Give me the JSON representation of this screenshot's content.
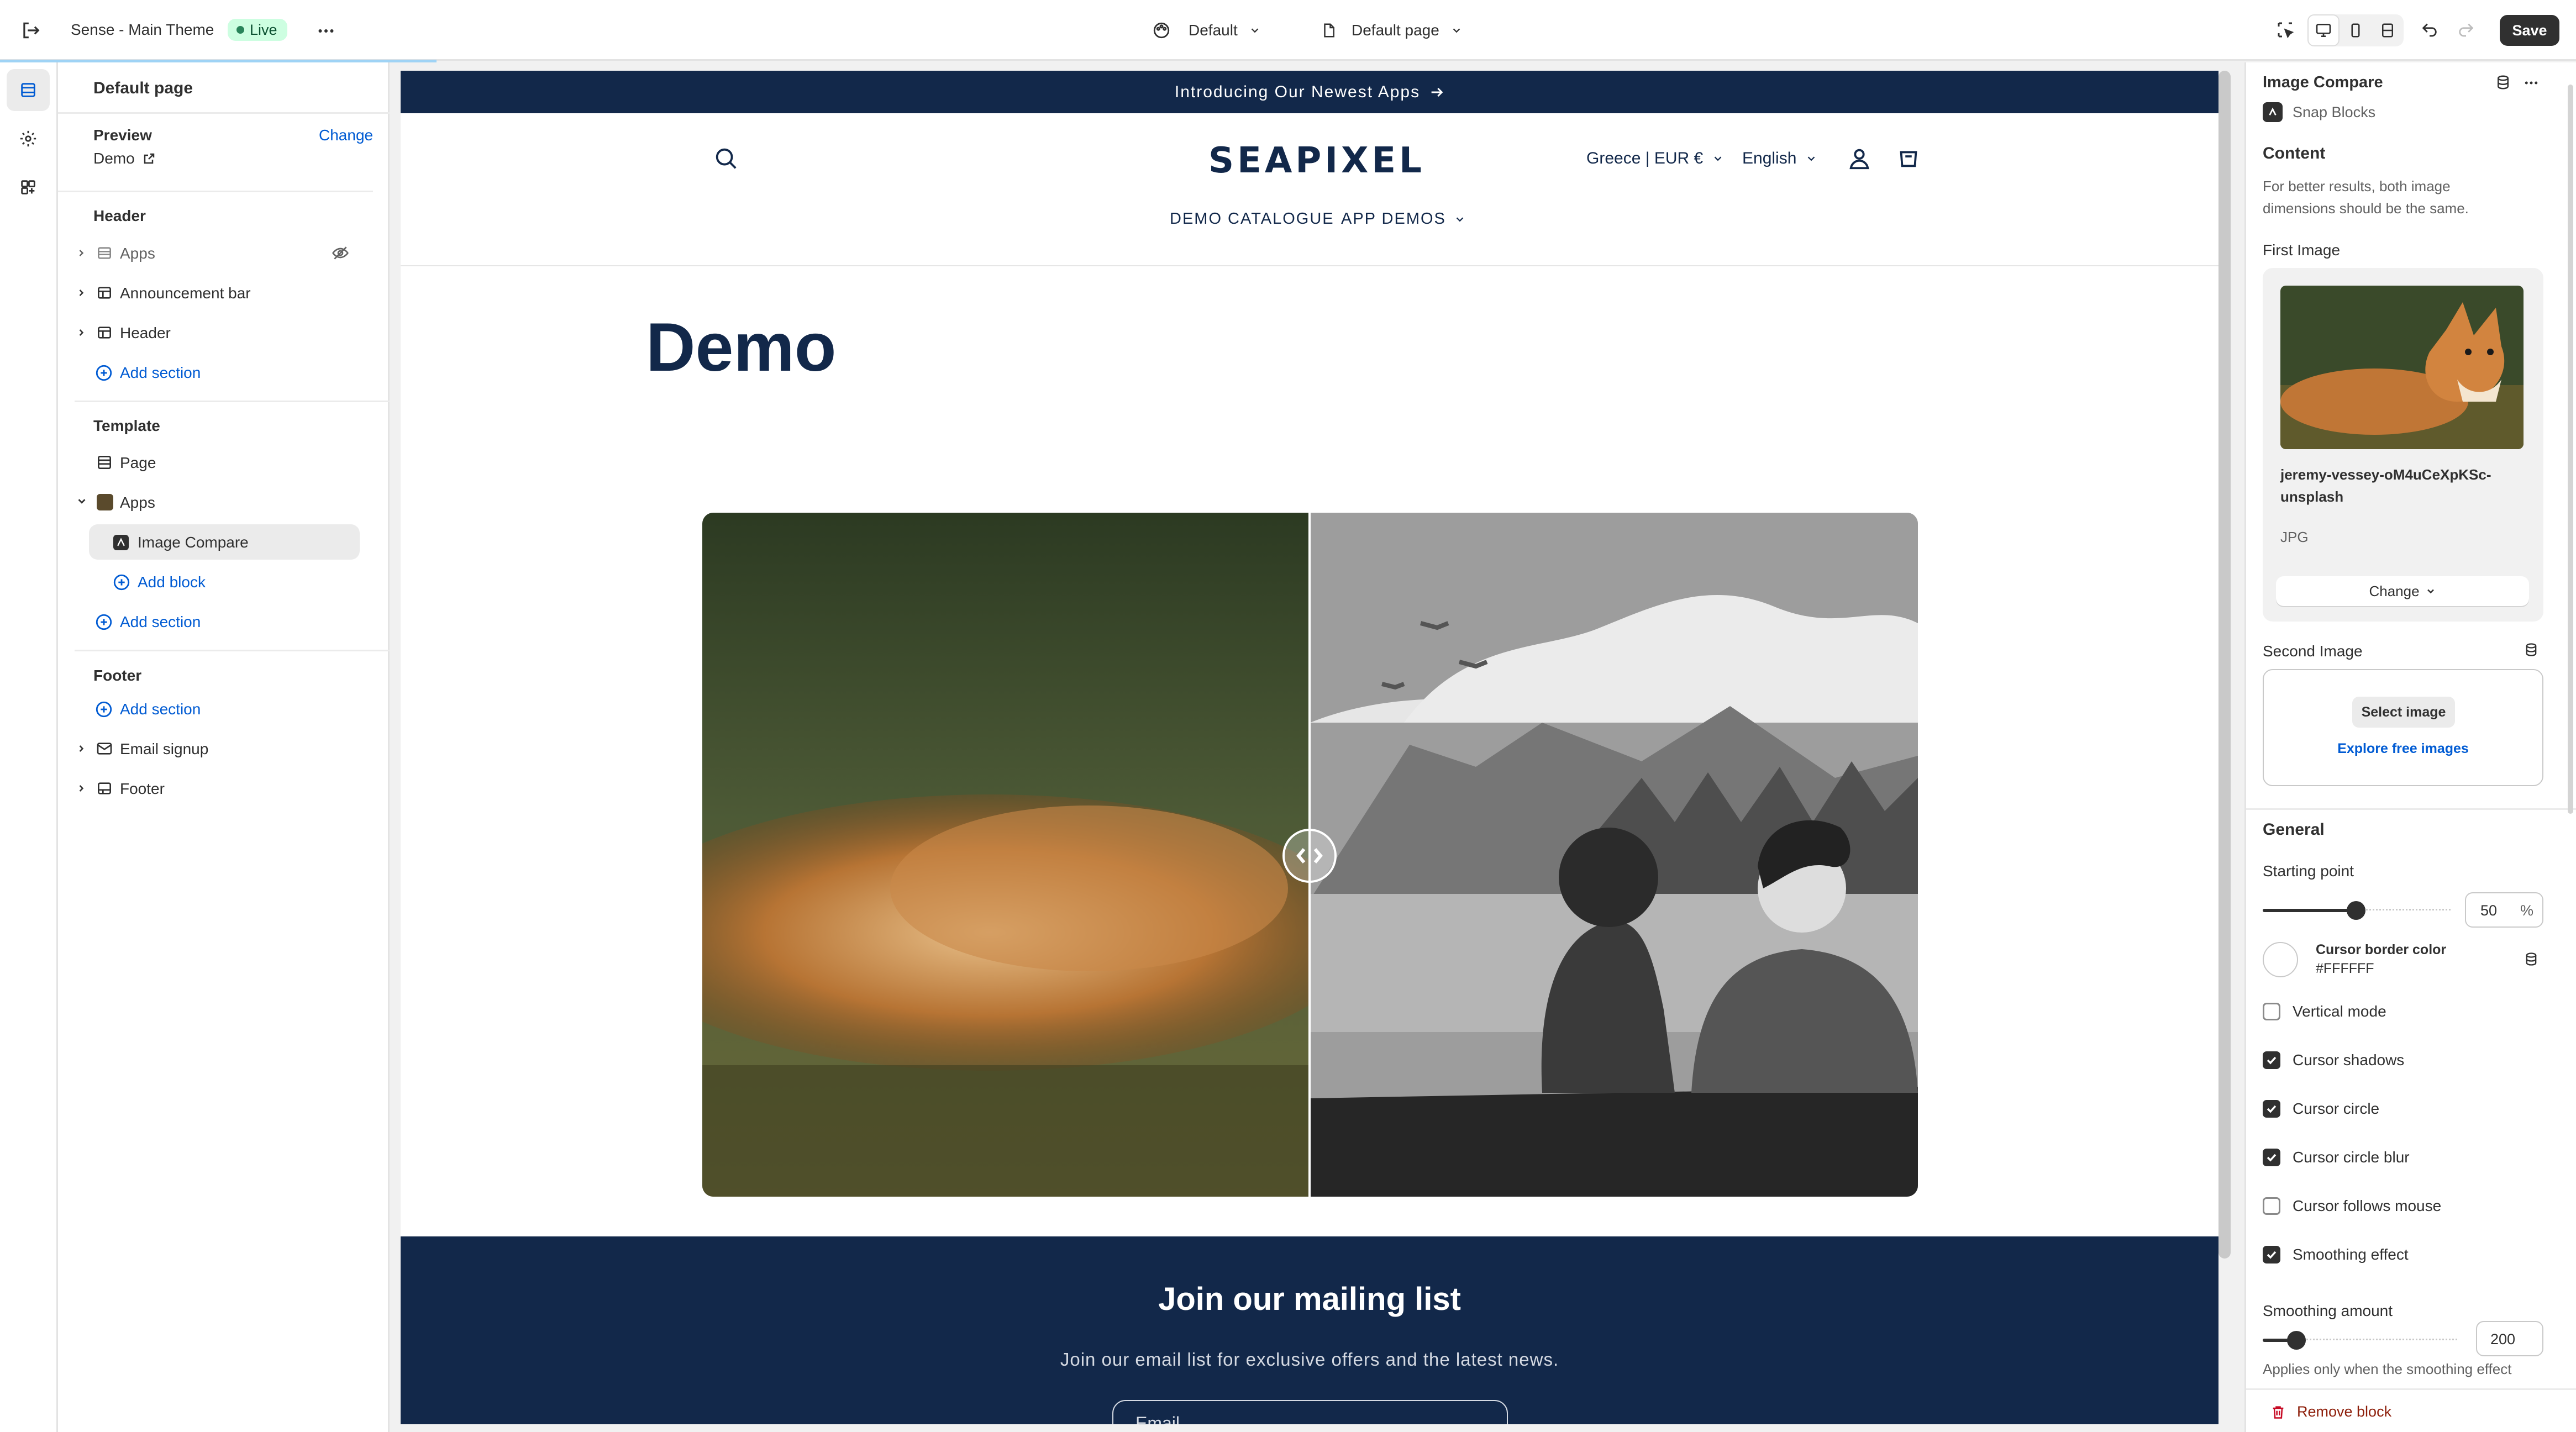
{
  "topbar": {
    "theme_name": "Sense - Main Theme",
    "live_badge": "Live",
    "theme_select": "Default",
    "page_select": "Default page",
    "save_label": "Save"
  },
  "left_panel": {
    "title": "Default page",
    "preview_label": "Preview",
    "change_label": "Change",
    "demo_link": "Demo",
    "header_group": "Header",
    "header_items": [
      "Apps",
      "Announcement bar",
      "Header"
    ],
    "add_section": "Add section",
    "template_group": "Template",
    "page_item": "Page",
    "apps_item": "Apps",
    "block_item": "Image Compare",
    "add_block": "Add block",
    "footer_group": "Footer",
    "footer_items": [
      "Email signup",
      "Footer"
    ]
  },
  "store": {
    "announcement": "Introducing Our Newest Apps",
    "logo": "SEAPIXEL",
    "country": "Greece | EUR €",
    "language": "English",
    "nav": [
      "DEMO CATALOGUE",
      "APP DEMOS"
    ],
    "page_title": "Demo",
    "newsletter_title": "Join our mailing list",
    "newsletter_sub": "Join our email list for exclusive offers and the latest news.",
    "email_placeholder": "Email"
  },
  "right_panel": {
    "block_title": "Image Compare",
    "app_name": "Snap Blocks",
    "content_heading": "Content",
    "content_help": [
      "For better results, both image",
      "dimensions should be the same."
    ],
    "first_image_label": "First Image",
    "first_image_name": [
      "jeremy-vessey-oM4uCeXpKSc-",
      "unsplash"
    ],
    "first_image_type": "JPG",
    "change_button": "Change",
    "second_image_label": "Second Image",
    "select_image": "Select image",
    "explore_images": "Explore free images",
    "general_heading": "General",
    "starting_point_label": "Starting point",
    "starting_point_value": "50",
    "starting_point_unit": "%",
    "cursor_border_label": "Cursor border color",
    "cursor_border_value": "#FFFFFF",
    "checkboxes": [
      {
        "label": "Vertical mode",
        "checked": false
      },
      {
        "label": "Cursor shadows",
        "checked": true
      },
      {
        "label": "Cursor circle",
        "checked": true
      },
      {
        "label": "Cursor circle blur",
        "checked": true
      },
      {
        "label": "Cursor follows mouse",
        "checked": false
      },
      {
        "label": "Smoothing effect",
        "checked": true
      }
    ],
    "smoothing_label": "Smoothing amount",
    "smoothing_value": "200",
    "smoothing_help": "Applies only when the smoothing effect",
    "remove_block": "Remove block"
  },
  "colors": {
    "navy": "#12284a",
    "accent_blue": "#005bd3",
    "dark_button": "#303030",
    "live_green": "#29845a",
    "danger": "#8e1f0b"
  }
}
